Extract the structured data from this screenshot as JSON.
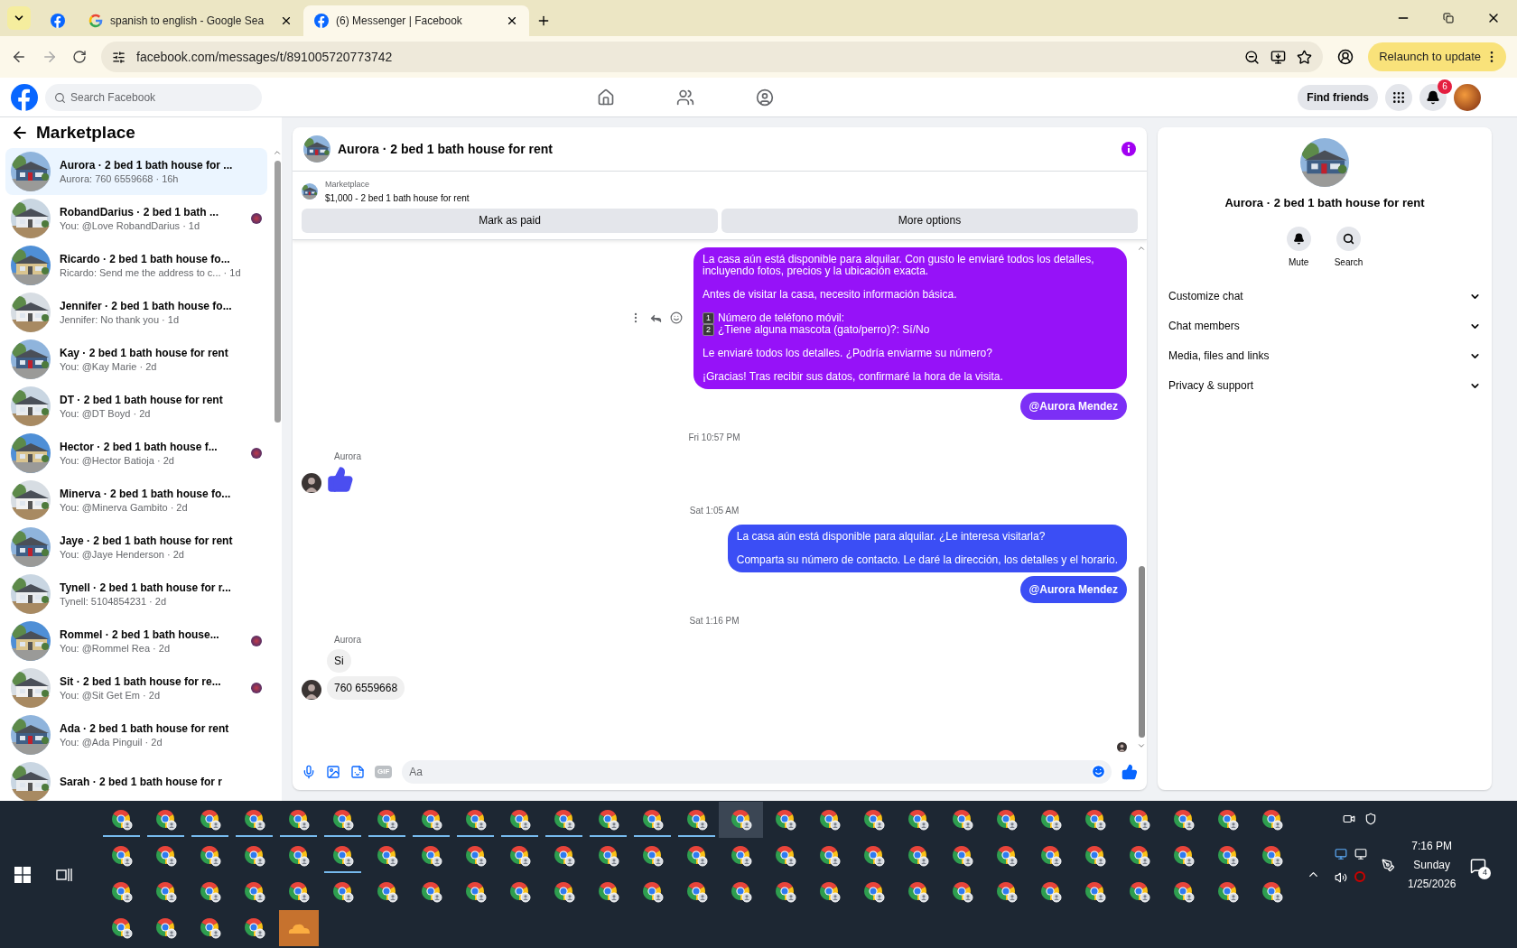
{
  "browser": {
    "tabs": [
      {
        "kind": "facebook",
        "selected": false
      },
      {
        "kind": "google",
        "label": "spanish to english - Google Sea",
        "selected": false
      },
      {
        "kind": "facebook",
        "label": "(6) Messenger | Facebook",
        "selected": true
      }
    ],
    "url": "facebook.com/messages/t/891005720773742",
    "update_button": "Relaunch to update"
  },
  "header": {
    "search_placeholder": "Search Facebook",
    "find_friends": "Find friends",
    "notification_count": "6"
  },
  "sidebar": {
    "title": "Marketplace",
    "chats": [
      {
        "name": "Aurora · 2 bed 1 bath house for ...",
        "preview": "Aurora: 760 6559668 · 16h",
        "selected": true,
        "seen_avatar": false
      },
      {
        "name": "RobandDarius · 2 bed 1 bath ...",
        "preview": "You: @Love RobandDarius · 1d",
        "selected": false,
        "seen_avatar": true
      },
      {
        "name": "Ricardo · 2 bed 1 bath house fo...",
        "preview": "Ricardo: Send me the address to c... · 1d",
        "selected": false,
        "seen_avatar": false
      },
      {
        "name": "Jennifer · 2 bed 1 bath house fo...",
        "preview": "Jennifer: No thank you · 1d",
        "selected": false,
        "seen_avatar": false
      },
      {
        "name": "Kay · 2 bed 1 bath house for rent",
        "preview": "You: @Kay Marie · 2d",
        "selected": false,
        "seen_avatar": false
      },
      {
        "name": "DT · 2 bed 1 bath house for rent",
        "preview": "You: @DT Boyd · 2d",
        "selected": false,
        "seen_avatar": false
      },
      {
        "name": "Hector · 2 bed 1 bath house f...",
        "preview": "You: @Hector Batioja · 2d",
        "selected": false,
        "seen_avatar": true
      },
      {
        "name": "Minerva · 2 bed 1 bath house fo...",
        "preview": "You: @Minerva Gambito · 2d",
        "selected": false,
        "seen_avatar": false
      },
      {
        "name": "Jaye · 2 bed 1 bath house for rent",
        "preview": "You: @Jaye Henderson · 2d",
        "selected": false,
        "seen_avatar": false
      },
      {
        "name": "Tynell · 2 bed 1 bath house for r...",
        "preview": "Tynell: 5104854231 · 2d",
        "selected": false,
        "seen_avatar": false
      },
      {
        "name": "Rommel · 2 bed 1 bath house...",
        "preview": "You: @Rommel Rea · 2d",
        "selected": false,
        "seen_avatar": true
      },
      {
        "name": "Sit · 2 bed 1 bath house for re...",
        "preview": "You: @Sit Get Em · 2d",
        "selected": false,
        "seen_avatar": true
      },
      {
        "name": "Ada · 2 bed 1 bath house for rent",
        "preview": "You: @Ada Pinguil · 2d",
        "selected": false,
        "seen_avatar": false
      },
      {
        "name": "Sarah · 2 bed 1 bath house for r",
        "selected": false,
        "seen_avatar": false
      }
    ]
  },
  "chat": {
    "title": "Aurora · 2 bed 1 bath house for rent",
    "listing_source": "Marketplace",
    "listing": "$1,000 - 2 bed 1 bath house for rent",
    "actions": [
      "Mark as paid",
      "More options"
    ],
    "messages": [
      {
        "kind": "outgoing",
        "color": "#9612f8",
        "hover_actions": true,
        "blocks": [
          {
            "kind": "text",
            "text": "La casa aún está disponible para alquilar. Con gusto le enviaré todos los detalles, incluyendo fotos, precios y la ubicación exacta."
          },
          {
            "kind": "text",
            "text": "Antes de visitar la casa, necesito información básica."
          },
          {
            "kind": "numbered",
            "items": [
              {
                "badge": "1",
                "text": "Número de teléfono móvil:"
              },
              {
                "badge": "2",
                "text": "¿Tiene alguna mascota (gato/perro)?: Sí/No"
              }
            ]
          },
          {
            "kind": "text",
            "text": "Le enviaré todos los detalles. ¿Podría enviarme su número?"
          },
          {
            "kind": "text",
            "text": "¡Gracias! Tras recibir sus datos, confirmaré la hora de la visita."
          }
        ]
      },
      {
        "kind": "mention",
        "text": "@Aurora Mendez",
        "color": "#7c2ff6"
      },
      {
        "kind": "timestamp",
        "text": "Fri 10:57 PM"
      },
      {
        "kind": "incoming",
        "sender": "Aurora",
        "bubbles": [
          {
            "kind": "like"
          }
        ]
      },
      {
        "kind": "timestamp",
        "text": "Sat 1:05 AM"
      },
      {
        "kind": "outgoing",
        "color": "#3b4ef5",
        "hover_actions": false,
        "blocks": [
          {
            "kind": "text",
            "text": "La casa aún está disponible para alquilar. ¿Le interesa visitarla?"
          },
          {
            "kind": "text",
            "text": "Comparta su número de contacto. Le daré la dirección, los detalles y el horario."
          }
        ]
      },
      {
        "kind": "mention",
        "text": "@Aurora Mendez",
        "color": "#3b4ef5"
      },
      {
        "kind": "timestamp",
        "text": "Sat 1:16 PM"
      },
      {
        "kind": "incoming",
        "sender": "Aurora",
        "bubbles": [
          {
            "kind": "text",
            "text": "Si"
          },
          {
            "kind": "text",
            "text": "760 6559668"
          }
        ]
      }
    ],
    "seen": true,
    "gif_label": "GIF",
    "input_placeholder": "Aa"
  },
  "details": {
    "title": "Aurora · 2 bed 1 bath house for rent",
    "actions": [
      {
        "kind": "mute",
        "label": "Mute"
      },
      {
        "kind": "search",
        "label": "Search"
      }
    ],
    "sections": [
      {
        "label": "Customize chat",
        "expanded": false
      },
      {
        "label": "Chat members",
        "expanded": false
      },
      {
        "label": "Media, files and links",
        "expanded": false
      },
      {
        "label": "Privacy & support",
        "expanded": false
      }
    ]
  },
  "taskbar": {
    "apps": [
      {
        "kind": "chrome",
        "running": true,
        "active": false
      },
      {
        "kind": "chrome",
        "running": true,
        "active": false
      },
      {
        "kind": "chrome",
        "running": true,
        "active": false
      },
      {
        "kind": "chrome",
        "running": true,
        "active": false
      },
      {
        "kind": "chrome",
        "running": true,
        "active": false
      },
      {
        "kind": "chrome",
        "running": true,
        "active": false
      },
      {
        "kind": "chrome",
        "running": true,
        "active": false
      },
      {
        "kind": "chrome",
        "running": true,
        "active": false
      },
      {
        "kind": "chrome",
        "running": true,
        "active": false
      },
      {
        "kind": "chrome",
        "running": true,
        "active": false
      },
      {
        "kind": "chrome",
        "running": true,
        "active": false
      },
      {
        "kind": "chrome",
        "running": true,
        "active": false
      },
      {
        "kind": "chrome",
        "running": true,
        "active": false
      },
      {
        "kind": "chrome",
        "running": true,
        "active": false
      },
      {
        "kind": "chrome",
        "running": false,
        "active": true
      },
      {
        "kind": "chrome",
        "running": false,
        "active": false
      },
      {
        "kind": "chrome",
        "running": false,
        "active": false
      },
      {
        "kind": "chrome",
        "running": false,
        "active": false
      },
      {
        "kind": "chrome",
        "running": false,
        "active": false
      },
      {
        "kind": "chrome",
        "running": false,
        "active": false
      },
      {
        "kind": "chrome",
        "running": false,
        "active": false
      },
      {
        "kind": "chrome",
        "running": false,
        "active": false
      },
      {
        "kind": "chrome",
        "running": false,
        "active": false
      },
      {
        "kind": "chrome",
        "running": false,
        "active": false
      },
      {
        "kind": "chrome",
        "running": false,
        "active": false
      },
      {
        "kind": "chrome",
        "running": false,
        "active": false
      },
      {
        "kind": "chrome",
        "running": false,
        "active": false
      },
      {
        "kind": "chrome",
        "running": false,
        "active": false
      },
      {
        "kind": "chrome",
        "running": false,
        "active": false
      },
      {
        "kind": "chrome",
        "running": false,
        "active": false
      },
      {
        "kind": "chrome",
        "running": false,
        "active": false
      },
      {
        "kind": "chrome",
        "running": false,
        "active": false
      },
      {
        "kind": "chrome",
        "running": true,
        "active": false
      },
      {
        "kind": "chrome",
        "running": false,
        "active": false
      },
      {
        "kind": "chrome",
        "running": false,
        "active": false
      },
      {
        "kind": "chrome",
        "running": false,
        "active": false
      },
      {
        "kind": "chrome",
        "running": false,
        "active": false
      },
      {
        "kind": "chrome",
        "running": false,
        "active": false
      },
      {
        "kind": "chrome",
        "running": false,
        "active": false
      },
      {
        "kind": "chrome",
        "running": false,
        "active": false
      },
      {
        "kind": "chrome",
        "running": false,
        "active": false
      },
      {
        "kind": "chrome",
        "running": false,
        "active": false
      },
      {
        "kind": "chrome",
        "running": false,
        "active": false
      },
      {
        "kind": "chrome",
        "running": false,
        "active": false
      },
      {
        "kind": "chrome",
        "running": false,
        "active": false
      },
      {
        "kind": "chrome",
        "running": false,
        "active": false
      },
      {
        "kind": "chrome",
        "running": false,
        "active": false
      },
      {
        "kind": "chrome",
        "running": false,
        "active": false
      },
      {
        "kind": "chrome",
        "running": false,
        "active": false
      },
      {
        "kind": "chrome",
        "running": false,
        "active": false
      },
      {
        "kind": "chrome",
        "running": false,
        "active": false
      },
      {
        "kind": "chrome",
        "running": false,
        "active": false
      },
      {
        "kind": "chrome",
        "running": false,
        "active": false
      },
      {
        "kind": "chrome",
        "running": false,
        "active": false
      },
      {
        "kind": "chrome",
        "running": false,
        "active": false
      },
      {
        "kind": "chrome",
        "running": false,
        "active": false
      },
      {
        "kind": "chrome",
        "running": false,
        "active": false
      },
      {
        "kind": "chrome",
        "running": false,
        "active": false
      },
      {
        "kind": "chrome",
        "running": false,
        "active": false
      },
      {
        "kind": "chrome",
        "running": false,
        "active": false
      },
      {
        "kind": "chrome",
        "running": false,
        "active": false
      },
      {
        "kind": "chrome",
        "running": false,
        "active": false
      },
      {
        "kind": "chrome",
        "running": false,
        "active": false
      },
      {
        "kind": "chrome",
        "running": false,
        "active": false
      },
      {
        "kind": "chrome",
        "running": false,
        "active": false
      },
      {
        "kind": "chrome",
        "running": false,
        "active": false
      },
      {
        "kind": "chrome",
        "running": false,
        "active": false
      },
      {
        "kind": "chrome",
        "running": false,
        "active": false
      },
      {
        "kind": "chrome",
        "running": false,
        "active": false
      },
      {
        "kind": "chrome",
        "running": false,
        "active": false
      },
      {
        "kind": "chrome",
        "running": false,
        "active": false
      },
      {
        "kind": "chrome",
        "running": false,
        "active": false
      },
      {
        "kind": "chrome",
        "running": false,
        "active": false
      },
      {
        "kind": "chrome",
        "running": false,
        "active": false
      },
      {
        "kind": "chrome",
        "running": false,
        "active": false
      },
      {
        "kind": "chrome",
        "running": false,
        "active": false
      },
      {
        "kind": "chrome",
        "running": false,
        "active": false
      },
      {
        "kind": "chrome",
        "running": false,
        "active": false
      },
      {
        "kind": "chrome",
        "running": false,
        "active": false
      },
      {
        "kind": "chrome",
        "running": false,
        "active": false
      },
      {
        "kind": "chrome",
        "running": false,
        "active": false
      },
      {
        "kind": "chrome",
        "running": false,
        "active": false
      },
      {
        "kind": "chrome",
        "running": false,
        "active": false
      },
      {
        "kind": "chrome",
        "running": false,
        "active": false
      },
      {
        "kind": "chrome",
        "running": false,
        "active": false
      },
      {
        "kind": "cloud",
        "running": false,
        "active": false
      }
    ],
    "time": "7:16 PM",
    "day": "Sunday",
    "date": "1/25/2026",
    "notifications": "4"
  }
}
